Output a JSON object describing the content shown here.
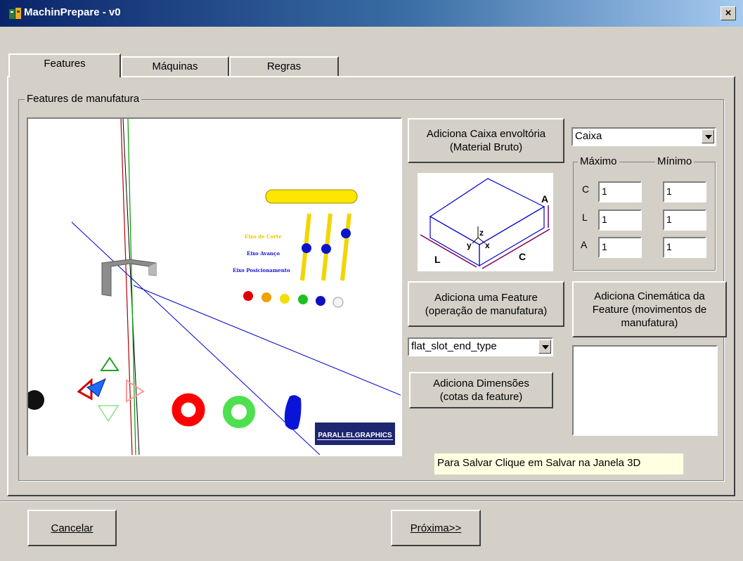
{
  "window": {
    "title": "MachinPrepare - v0",
    "close": "×"
  },
  "tabs": [
    {
      "label": "Features",
      "active": true
    },
    {
      "label": "Máquinas",
      "active": false
    },
    {
      "label": "Regras",
      "active": false
    }
  ],
  "features_group": {
    "legend": "Features de manufatura"
  },
  "viewer": {
    "labels": [
      "Eixo de Corte",
      "Eixo Avanço",
      "Eixo Posicionamento"
    ],
    "logo": "PARALLELGRAPHICS"
  },
  "buttons": {
    "add_box": "Adiciona Caixa envoltória\n(Material Bruto)",
    "add_feature": "Adiciona uma Feature\n(operação de manufatura)",
    "add_kinematics": "Adiciona Cinemática da\nFeature (movimentos de\nmanufatura)",
    "add_dimensions": "Adiciona Dimensões\n(cotas da feature)",
    "cancel": "Cancelar",
    "next": "Próxima>>"
  },
  "shape_select": {
    "value": "Caixa"
  },
  "feature_select": {
    "value": "flat_slot_end_type"
  },
  "box_diagram": {
    "labels": {
      "a": "A",
      "l": "L",
      "c": "C",
      "z": "z",
      "y": "y",
      "x": "x"
    }
  },
  "dims": {
    "max_label": "Máximo",
    "min_label": "Mínimo",
    "rows": [
      {
        "label": "C",
        "max": "1",
        "min": "1"
      },
      {
        "label": "L",
        "max": "1",
        "min": "1"
      },
      {
        "label": "A",
        "max": "1",
        "min": "1"
      }
    ]
  },
  "status_text": "Para Salvar Clique em Salvar na Janela 3D"
}
